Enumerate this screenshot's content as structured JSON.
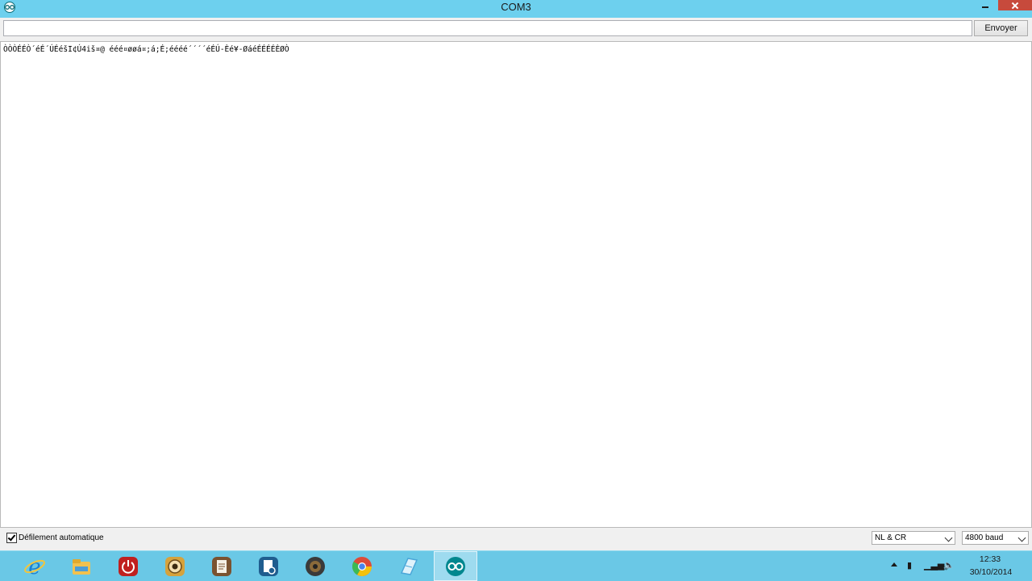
{
  "window": {
    "title": "COM3"
  },
  "toolbar": {
    "input_value": "",
    "send_label": "Envoyer"
  },
  "output": {
    "text": "ÒÒÒÉÉÒ´éÉ´ÚÉéšI¢Ú4iš¤@ ééé¤øøá¤;á;É;éééé´´´´éÉÚ-Èé¥-ØáéÉÉÉÉÈØÒ"
  },
  "footer": {
    "autoscroll_label": "Défilement automatique",
    "autoscroll_checked": true,
    "line_ending": "NL & CR",
    "baud": "4800 baud"
  },
  "taskbar": {
    "apps": [
      {
        "icon": "internet-explorer-icon",
        "color": "#1b7fd1"
      },
      {
        "icon": "file-explorer-icon",
        "color": "#f2c14e"
      },
      {
        "icon": "power-icon",
        "color": "#c0201f"
      },
      {
        "icon": "webcam-icon",
        "color": "#d6a23c"
      },
      {
        "icon": "document-icon",
        "color": "#7a5230"
      },
      {
        "icon": "settings-document-icon",
        "color": "#1f5d8f"
      },
      {
        "icon": "speaker-icon",
        "color": "#3a3a3a"
      },
      {
        "icon": "chrome-icon",
        "color": "#dd4b39"
      },
      {
        "icon": "notepad-icon",
        "color": "#4aa6d8"
      },
      {
        "icon": "arduino-icon",
        "color": "#00878f"
      }
    ],
    "time": "12:33",
    "date": "30/10/2014"
  }
}
